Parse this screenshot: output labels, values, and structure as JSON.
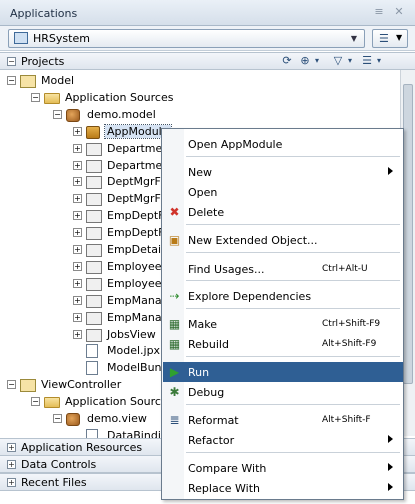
{
  "panel": {
    "title": "Applications",
    "app_selector_value": "HRSystem"
  },
  "projects": {
    "label": "Projects"
  },
  "tree": [
    {
      "label": "Model",
      "icon": "project",
      "exp": "-"
    },
    {
      "label": "Application Sources",
      "icon": "folder",
      "exp": "-"
    },
    {
      "label": "demo.model",
      "icon": "package",
      "exp": "-"
    },
    {
      "label": "AppModule",
      "icon": "app-module",
      "exp": "+",
      "selected": true
    },
    {
      "label": "Departmen",
      "icon": "view-object",
      "exp": "+"
    },
    {
      "label": "Departmen",
      "icon": "entity",
      "exp": "+"
    },
    {
      "label": "DeptMgrFk",
      "icon": "association",
      "exp": "+"
    },
    {
      "label": "DeptMgrFk",
      "icon": "association",
      "exp": "+"
    },
    {
      "label": "EmpDeptFk",
      "icon": "association",
      "exp": "+"
    },
    {
      "label": "EmpDeptFk",
      "icon": "association",
      "exp": "+"
    },
    {
      "label": "EmpDetails",
      "icon": "view-object",
      "exp": "+"
    },
    {
      "label": "Employees",
      "icon": "view-object",
      "exp": "+"
    },
    {
      "label": "Employees",
      "icon": "entity",
      "exp": "+"
    },
    {
      "label": "EmpManag",
      "icon": "association",
      "exp": "+"
    },
    {
      "label": "EmpManag",
      "icon": "association",
      "exp": "+"
    },
    {
      "label": "JobsView",
      "icon": "view-object",
      "exp": "+"
    },
    {
      "label": "Model.jpx",
      "icon": "jpx-file",
      "exp": ""
    },
    {
      "label": "ModelBund",
      "icon": "bundle-file",
      "exp": ""
    },
    {
      "label": "ViewController",
      "icon": "project",
      "exp": "-"
    },
    {
      "label": "Application Sources",
      "icon": "folder",
      "exp": "-"
    },
    {
      "label": "demo.view",
      "icon": "package",
      "exp": "-"
    },
    {
      "label": "DataBindin",
      "icon": "file",
      "exp": ""
    }
  ],
  "sections": {
    "application_resources": "Application Resources",
    "data_controls": "Data Controls",
    "recent_files": "Recent Files"
  },
  "context_menu": {
    "items": [
      {
        "label": "Open AppModule",
        "accel": "",
        "submenu": false,
        "icon": ""
      },
      {
        "label": "New",
        "accel": "",
        "submenu": true,
        "icon": ""
      },
      {
        "label": "Open",
        "accel": "",
        "submenu": false,
        "icon": ""
      },
      {
        "label": "Delete",
        "accel": "",
        "submenu": false,
        "icon": "delete-x-icon"
      },
      {
        "label": "New Extended Object...",
        "accel": "",
        "submenu": false,
        "icon": "extended-object-icon"
      },
      {
        "label": "Find Usages...",
        "accel": "Ctrl+Alt-U",
        "submenu": false,
        "icon": ""
      },
      {
        "label": "Explore Dependencies",
        "accel": "",
        "submenu": false,
        "icon": "dependencies-icon"
      },
      {
        "label": "Make",
        "accel": "Ctrl+Shift-F9",
        "submenu": false,
        "icon": "make-icon"
      },
      {
        "label": "Rebuild",
        "accel": "Alt+Shift-F9",
        "submenu": false,
        "icon": "rebuild-icon"
      },
      {
        "label": "Run",
        "accel": "",
        "submenu": false,
        "icon": "run-icon",
        "highlight": true
      },
      {
        "label": "Debug",
        "accel": "",
        "submenu": false,
        "icon": "debug-icon"
      },
      {
        "label": "Reformat",
        "accel": "Alt+Shift-F",
        "submenu": false,
        "icon": "reformat-icon"
      },
      {
        "label": "Refactor",
        "accel": "",
        "submenu": true,
        "icon": ""
      },
      {
        "label": "Compare With",
        "accel": "",
        "submenu": true,
        "icon": ""
      },
      {
        "label": "Replace With",
        "accel": "",
        "submenu": true,
        "icon": ""
      }
    ]
  },
  "colors": {
    "highlight": "#2f5f94",
    "selection": "#d6e3f3"
  }
}
